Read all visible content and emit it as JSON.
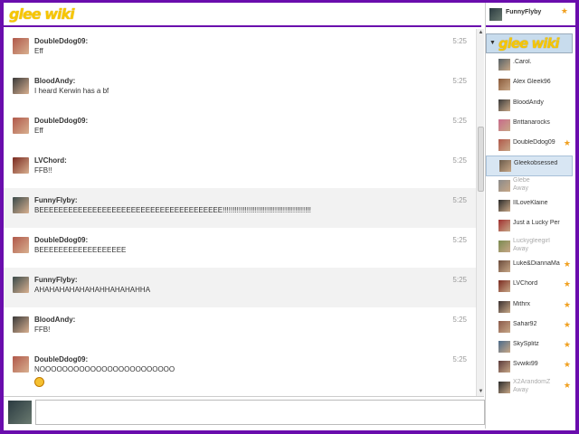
{
  "header": {
    "logo": "glee wiki"
  },
  "chat": {
    "messages": [
      {
        "user": "DoubleDdog09:",
        "text": "Eff",
        "time": "5:25",
        "avatar_color": "#b0584a",
        "alt": false
      },
      {
        "user": "BloodAndy:",
        "text": "I heard Kerwin has a bf",
        "time": "5:25",
        "avatar_color": "#3a3a3a",
        "alt": false
      },
      {
        "user": "DoubleDdog09:",
        "text": "Eff",
        "time": "5:25",
        "avatar_color": "#b0584a",
        "alt": false
      },
      {
        "user": "LVChord:",
        "text": "FFB!!",
        "time": "5:25",
        "avatar_color": "#7a2a20",
        "alt": false
      },
      {
        "user": "FunnyFlyby:",
        "text": "BEEEEEEEEEEEEEEEEEEEEEEEEEEEEEEEEEEEEEE!!!!!!!!!!!!!!!!!!!!!!!!!!!!!!!!!!!!!!!!!!!!",
        "time": "5:25",
        "avatar_color": "#3a4a4a",
        "alt": true
      },
      {
        "user": "DoubleDdog09:",
        "text": "BEEEEEEEEEEEEEEEEEE",
        "time": "5:25",
        "avatar_color": "#b0584a",
        "alt": false
      },
      {
        "user": "FunnyFlyby:",
        "text": "AHAHAHAHAHAHAHHAHAHAHHA",
        "time": "5:25",
        "avatar_color": "#3a4a4a",
        "alt": true
      },
      {
        "user": "BloodAndy:",
        "text": "FFB!",
        "time": "5:25",
        "avatar_color": "#3a3a3a",
        "alt": false
      },
      {
        "user": "DoubleDdog09:",
        "text": "NOOOOOOOOOOOOOOOOOOOOOOOO",
        "time": "5:25",
        "avatar_color": "#b0584a",
        "alt": false,
        "emoji": "smiley-face"
      }
    ]
  },
  "sidebar": {
    "me": {
      "name": "FunnyFlyby",
      "star": "★"
    },
    "wiki_logo": "glee wiki",
    "users": [
      {
        "name": ".Carol.",
        "star": false,
        "away": false,
        "avatar_color": "#556066"
      },
      {
        "name": "Alex Gleek96",
        "star": false,
        "away": false,
        "avatar_color": "#8a5a3a"
      },
      {
        "name": "BloodAndy",
        "star": false,
        "away": false,
        "avatar_color": "#3a3a3a"
      },
      {
        "name": "Brittanarocks",
        "star": false,
        "away": false,
        "avatar_color": "#c86a8a"
      },
      {
        "name": "DoubleDdog09",
        "star": true,
        "away": false,
        "avatar_color": "#b0584a"
      },
      {
        "name": "Gleekobsessed",
        "star": false,
        "away": false,
        "avatar_color": "#6a5a4a",
        "selected": true
      },
      {
        "name": "Glebe",
        "star": false,
        "away": true,
        "avatar_color": "#8a8a8a"
      },
      {
        "name": "IILoveKlaine",
        "star": false,
        "away": false,
        "avatar_color": "#2a2a2a"
      },
      {
        "name": "Just a Lucky Perr",
        "star": false,
        "away": false,
        "avatar_color": "#a03030"
      },
      {
        "name": "Luckygleegirl",
        "star": false,
        "away": true,
        "avatar_color": "#7a8a50"
      },
      {
        "name": "Luke&DiannaMag",
        "star": true,
        "away": false,
        "avatar_color": "#6a4a3a"
      },
      {
        "name": "LVChord",
        "star": true,
        "away": false,
        "avatar_color": "#7a2a20"
      },
      {
        "name": "Mithrx",
        "star": true,
        "away": false,
        "avatar_color": "#3a3030"
      },
      {
        "name": "Sahar92",
        "star": true,
        "away": false,
        "avatar_color": "#8a5a4a"
      },
      {
        "name": "SkySplitz",
        "star": true,
        "away": false,
        "avatar_color": "#4a6a8a"
      },
      {
        "name": "Svwiki99",
        "star": true,
        "away": false,
        "avatar_color": "#5a3a3a"
      },
      {
        "name": "X2ArandomZ",
        "star": true,
        "away": true,
        "avatar_color": "#2a2a2a"
      }
    ],
    "away_label": "Away",
    "star_glyph": "★"
  },
  "scrollbar": {
    "up": "▲",
    "down": "▼"
  },
  "colors": {
    "frame": "#6a0dad",
    "logo": "#f7c600",
    "star": "#f0a020"
  }
}
